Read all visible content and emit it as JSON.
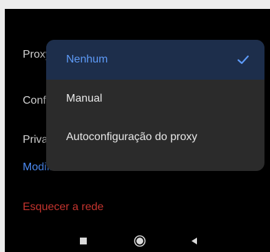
{
  "settings": {
    "proxy_label": "Proxy",
    "connection_label": "Conf",
    "privacy_label": "Priva"
  },
  "actions": {
    "modify_network": "Modificar rede",
    "forget_network": "Esquecer a rede"
  },
  "colors": {
    "accent": "#5e9bf8",
    "link_blue": "#4d8cf5",
    "danger_red": "#c5342e",
    "menu_background": "#2b2b2b",
    "selected_background": "#1d2e4b"
  },
  "proxy_menu": {
    "options": [
      {
        "label": "Nenhum",
        "selected": true
      },
      {
        "label": "Manual",
        "selected": false
      },
      {
        "label": "Autoconfiguração do proxy",
        "selected": false
      }
    ]
  },
  "navbar": {
    "icons": [
      "recent-apps-icon",
      "home-icon",
      "back-icon"
    ]
  }
}
